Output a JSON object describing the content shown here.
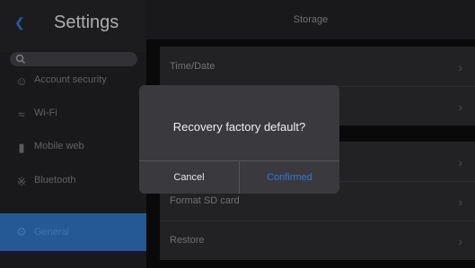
{
  "sidebar": {
    "title": "Settings",
    "items": [
      {
        "label": "Account security",
        "icon": "user-icon"
      },
      {
        "label": "Wi-Fi",
        "icon": "wifi-icon"
      },
      {
        "label": "Mobile web",
        "icon": "signal-icon"
      },
      {
        "label": "Bluetooth",
        "icon": "bluetooth-icon"
      },
      {
        "label": "General",
        "icon": "gear-icon"
      }
    ]
  },
  "main": {
    "title": "Storage",
    "rows": [
      {
        "label": "Time/Date"
      },
      {
        "label": ""
      },
      {
        "label": ""
      },
      {
        "label": "Format SD card"
      },
      {
        "label": "Restore"
      }
    ]
  },
  "dialog": {
    "message": "Recovery factory default?",
    "cancel_label": "Cancel",
    "confirm_label": "Confirmed"
  },
  "colors": {
    "accent": "#2d6db8",
    "confirm": "#2f77e0",
    "background": "#0c0c0d"
  }
}
